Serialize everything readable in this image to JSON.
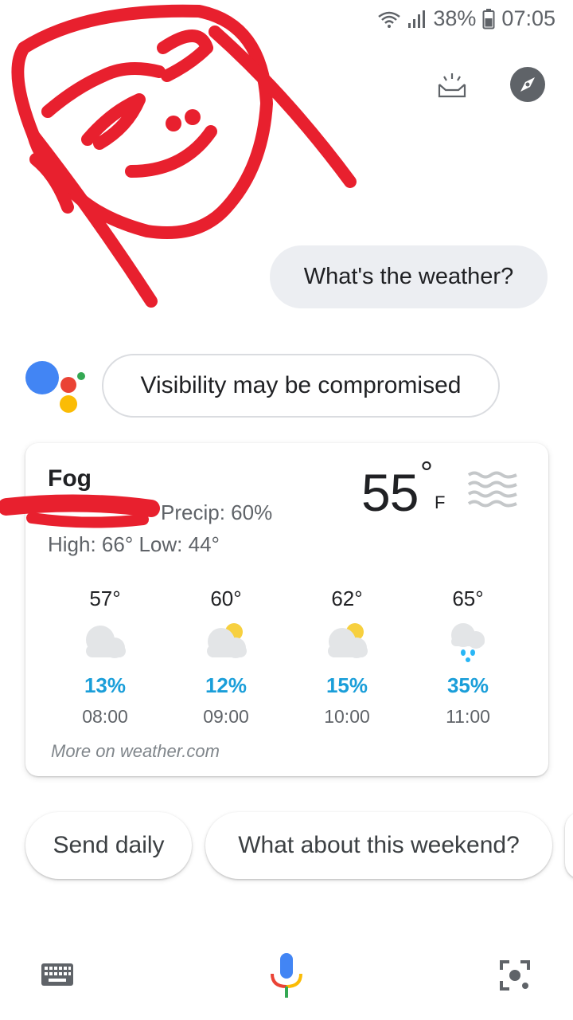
{
  "status_bar": {
    "battery": "38%",
    "time": "07:05"
  },
  "top_icons": [
    "snapshot-icon",
    "explore-icon"
  ],
  "conversation": {
    "user_query": "What's the weather?",
    "assistant_reply": "Visibility may be compromised"
  },
  "weather": {
    "condition": "Fog",
    "precip": "Precip: 60%",
    "high_low": "High: 66° Low: 44°",
    "temperature": "55",
    "degree_symbol": "°",
    "unit": "F",
    "icon": "fog-icon",
    "hourly": [
      {
        "temp": "57°",
        "icon": "cloudy-icon",
        "precip": "13%",
        "time": "08:00"
      },
      {
        "temp": "60°",
        "icon": "partly-sunny-icon",
        "precip": "12%",
        "time": "09:00"
      },
      {
        "temp": "62°",
        "icon": "partly-sunny-icon",
        "precip": "15%",
        "time": "10:00"
      },
      {
        "temp": "65°",
        "icon": "rain-icon",
        "precip": "35%",
        "time": "11:00"
      }
    ],
    "more_link": "More on weather.com"
  },
  "suggestions": [
    "Send daily",
    "What about this weekend?"
  ],
  "colors": {
    "precip_blue": "#1a9ed9",
    "bubble_grey": "#eceef2",
    "scribble_red": "#e8202e",
    "google_blue": "#4285f4",
    "google_red": "#ea4335",
    "google_yellow": "#fbbc05",
    "google_green": "#34a853"
  },
  "bottom_bar": [
    "keyboard-icon",
    "microphone-icon",
    "lens-icon"
  ]
}
